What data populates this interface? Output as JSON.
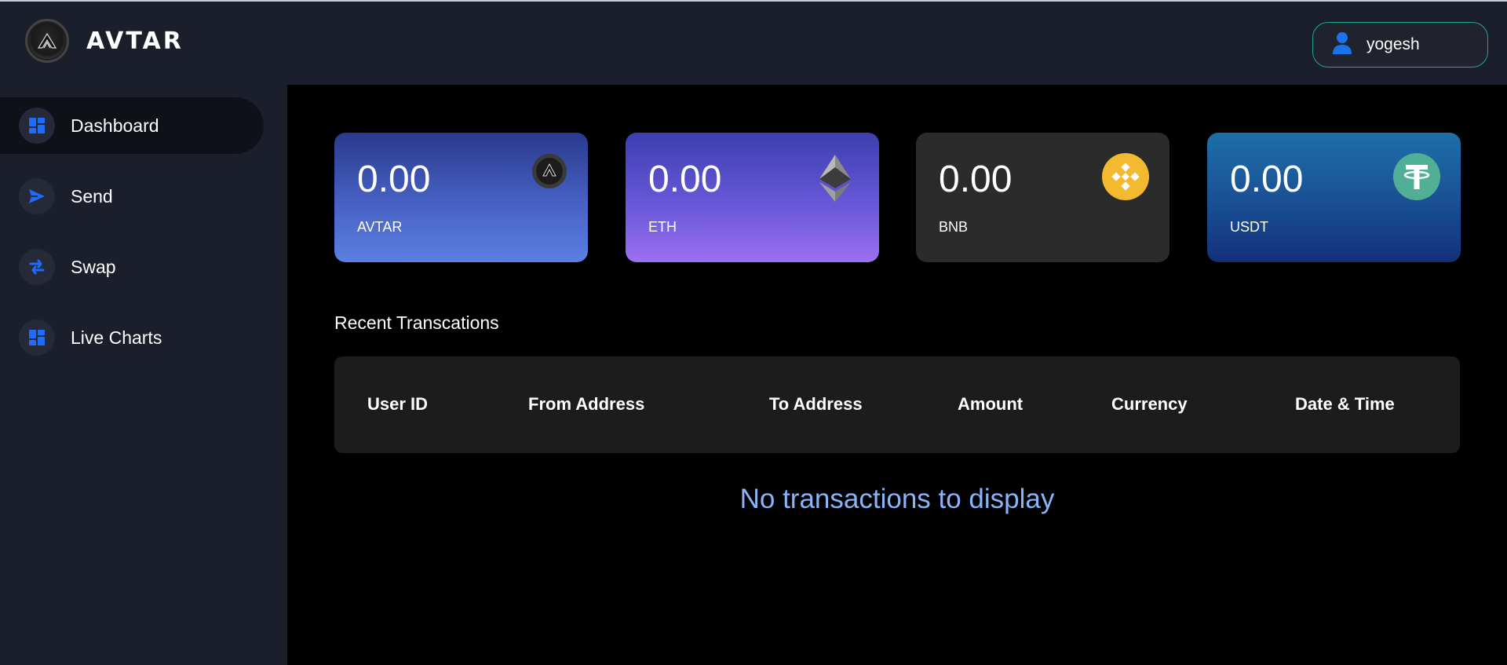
{
  "app": {
    "brand": "AVTAR"
  },
  "user": {
    "name": "yogesh",
    "icon": "user-icon",
    "accent": "#1fa98a"
  },
  "sidebar": {
    "items": [
      {
        "label": "Dashboard",
        "icon": "dashboard-icon",
        "active": true
      },
      {
        "label": "Send",
        "icon": "send-icon",
        "active": false
      },
      {
        "label": "Swap",
        "icon": "swap-icon",
        "active": false
      },
      {
        "label": "Live Charts",
        "icon": "dashboard-icon",
        "active": false
      }
    ]
  },
  "balances": [
    {
      "value": "0.00",
      "symbol": "AVTAR",
      "icon": "avtar-coin-icon"
    },
    {
      "value": "0.00",
      "symbol": "ETH",
      "icon": "ethereum-icon"
    },
    {
      "value": "0.00",
      "symbol": "BNB",
      "icon": "binance-icon",
      "color": "#f3ba2f"
    },
    {
      "value": "0.00",
      "symbol": "USDT",
      "icon": "tether-icon",
      "color": "#50af95"
    }
  ],
  "transactions": {
    "title": "Recent Transcations",
    "columns": [
      "User ID",
      "From Address",
      "To Address",
      "Amount",
      "Currency",
      "Date & Time"
    ],
    "rows": [],
    "empty_text": "No transactions to display",
    "empty_color": "#8ab4f8"
  }
}
